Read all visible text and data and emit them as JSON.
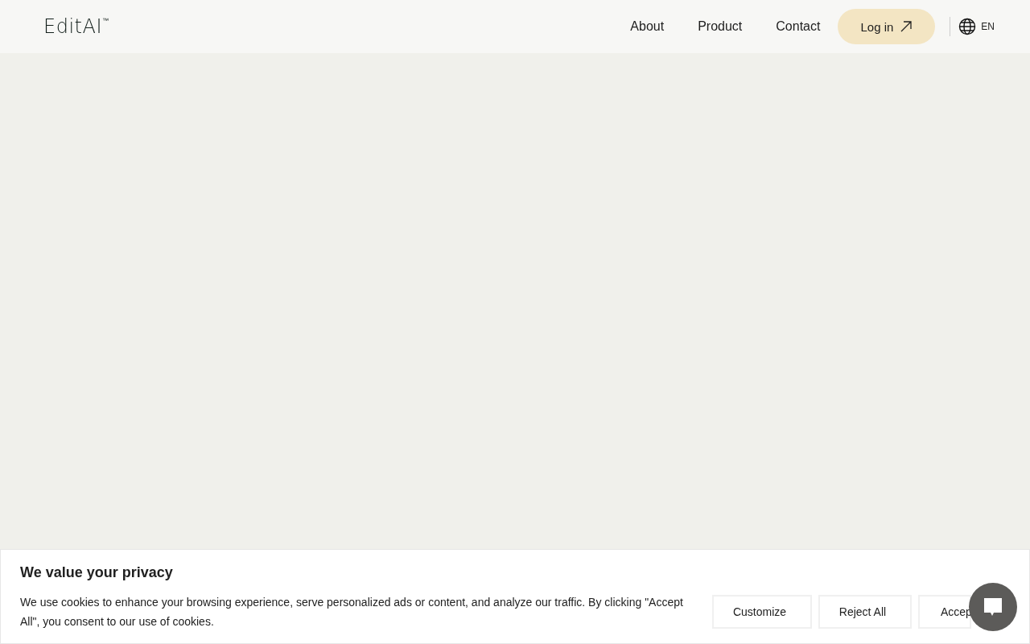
{
  "header": {
    "logo": "EditAI",
    "logo_mark": "™",
    "nav": [
      "About",
      "Product",
      "Contact"
    ],
    "login": "Log in",
    "language": "EN"
  },
  "cookie_banner": {
    "title": "We value your privacy",
    "text": "We use cookies to enhance your browsing experience, serve personalized ads or content, and analyze our traffic. By clicking \"Accept All\", you consent to our use of cookies.",
    "buttons": [
      "Customize",
      "Reject All",
      "Accep"
    ]
  }
}
